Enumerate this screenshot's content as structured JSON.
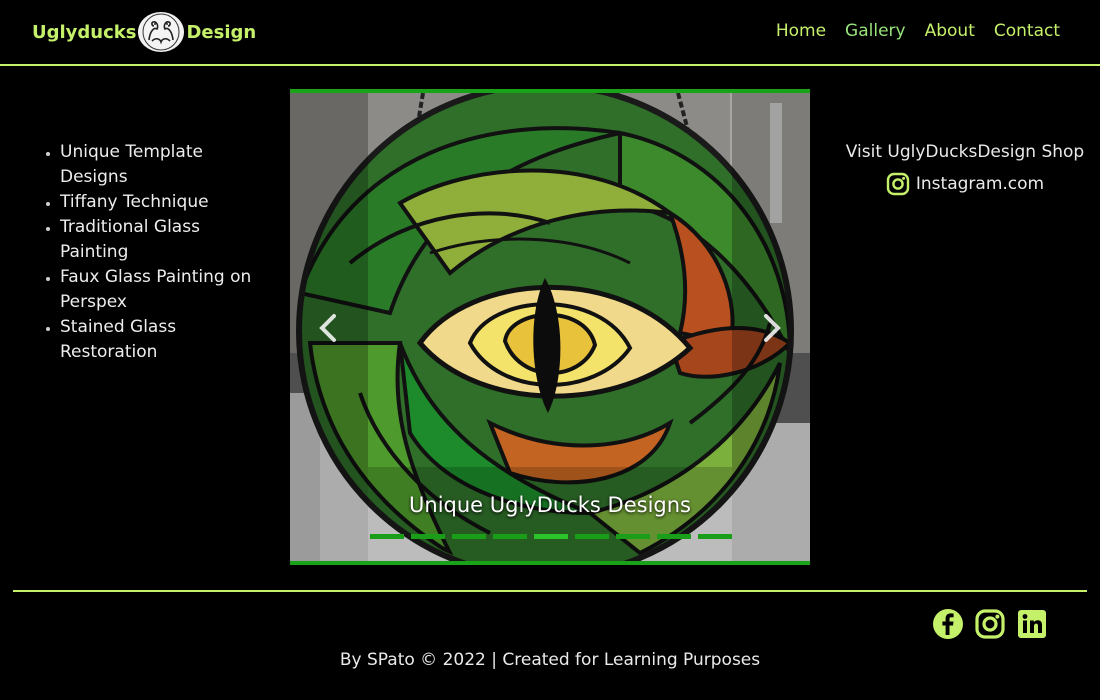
{
  "header": {
    "brand_left": "Uglyducks",
    "brand_right": "Design",
    "logo_icon": "duck-logo-icon",
    "accent": "#c5f06a",
    "nav": [
      {
        "label": "Home"
      },
      {
        "label": "Gallery",
        "active": true
      },
      {
        "label": "About"
      },
      {
        "label": "Contact"
      }
    ]
  },
  "services": [
    "Unique Template Designs",
    "Tiffany Technique",
    "Traditional Glass Painting",
    "Faux Glass Painting on Perspex",
    "Stained Glass Restoration"
  ],
  "carousel": {
    "caption": "Unique UglyDucks Designs",
    "prev_icon": "chevron-left-icon",
    "next_icon": "chevron-right-icon",
    "indicator_count": 9,
    "active_indicator": 4,
    "frame_color": "#19a319"
  },
  "shop": {
    "title": "Visit UglyDucksDesign Shop",
    "link": "Instagram.com",
    "icon": "instagram-icon"
  },
  "footer": {
    "socials": [
      "facebook-icon",
      "instagram-icon",
      "linkedin-icon"
    ],
    "copyright": "By SPato © 2022 | Created for Learning Purposes"
  }
}
